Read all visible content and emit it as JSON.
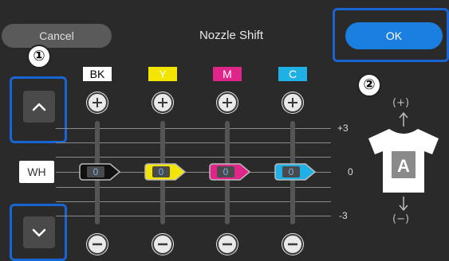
{
  "header": {
    "cancel_label": "Cancel",
    "title": "Nozzle Shift",
    "ok_label": "OK"
  },
  "callouts": {
    "badge_1": "①",
    "badge_2": "②"
  },
  "channels": [
    {
      "label": "BK",
      "value": "0",
      "label_bg": "#ffffff",
      "label_fg": "#000000",
      "accent": "#111111"
    },
    {
      "label": "Y",
      "value": "0",
      "label_bg": "#f3e500",
      "label_fg": "#ffffff",
      "accent": "#f3e500"
    },
    {
      "label": "M",
      "value": "0",
      "label_bg": "#e0258a",
      "label_fg": "#ffffff",
      "accent": "#e0258a"
    },
    {
      "label": "C",
      "value": "0",
      "label_bg": "#1fb1e6",
      "label_fg": "#ffffff",
      "accent": "#1fb1e6"
    }
  ],
  "row_label": "WH",
  "scale": {
    "top": "+3",
    "middle": "0",
    "bottom": "-3"
  },
  "preview": {
    "plus_label": "(+)",
    "minus_label": "(−)",
    "shirt_letter": "A"
  },
  "colors": {
    "accent_blue": "#1a7fe0",
    "callout_border": "#1866d6",
    "background": "#2a2a2a"
  },
  "icons": [
    "chevron-up-icon",
    "chevron-down-icon",
    "plus-icon",
    "minus-icon",
    "arrow-up-icon",
    "arrow-down-icon",
    "tshirt-icon"
  ]
}
